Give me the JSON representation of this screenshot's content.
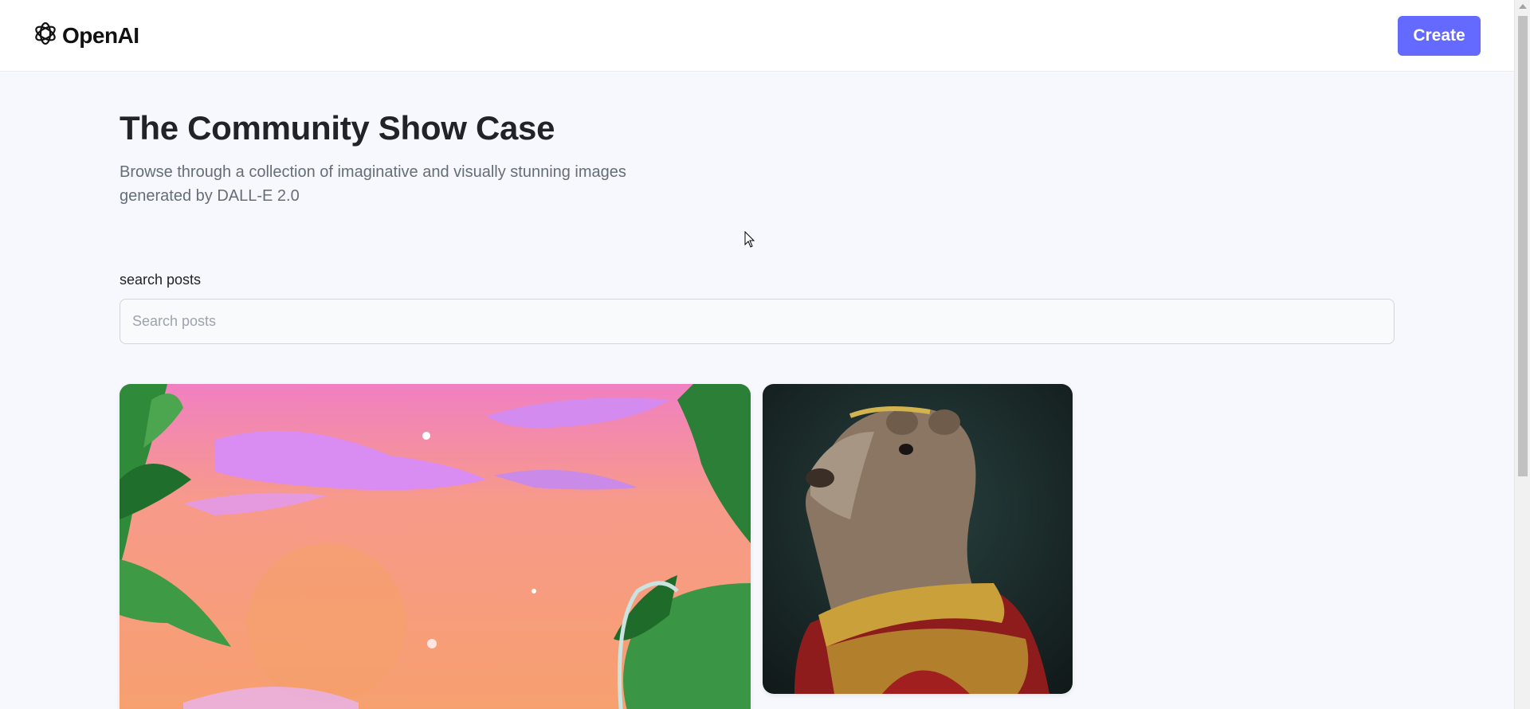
{
  "header": {
    "logo_text": "OpenAI",
    "create_label": "Create"
  },
  "main": {
    "title": "The Community Show Case",
    "subtitle": "Browse through a collection of imaginative and visually stunning images generated by DALL-E 2.0",
    "search_label": "search posts",
    "search_placeholder": "Search posts",
    "search_value": ""
  },
  "colors": {
    "accent": "#6469ff",
    "background": "#f6f8fd"
  },
  "icons": [
    "openai-logo-icon",
    "mouse-cursor-icon"
  ]
}
